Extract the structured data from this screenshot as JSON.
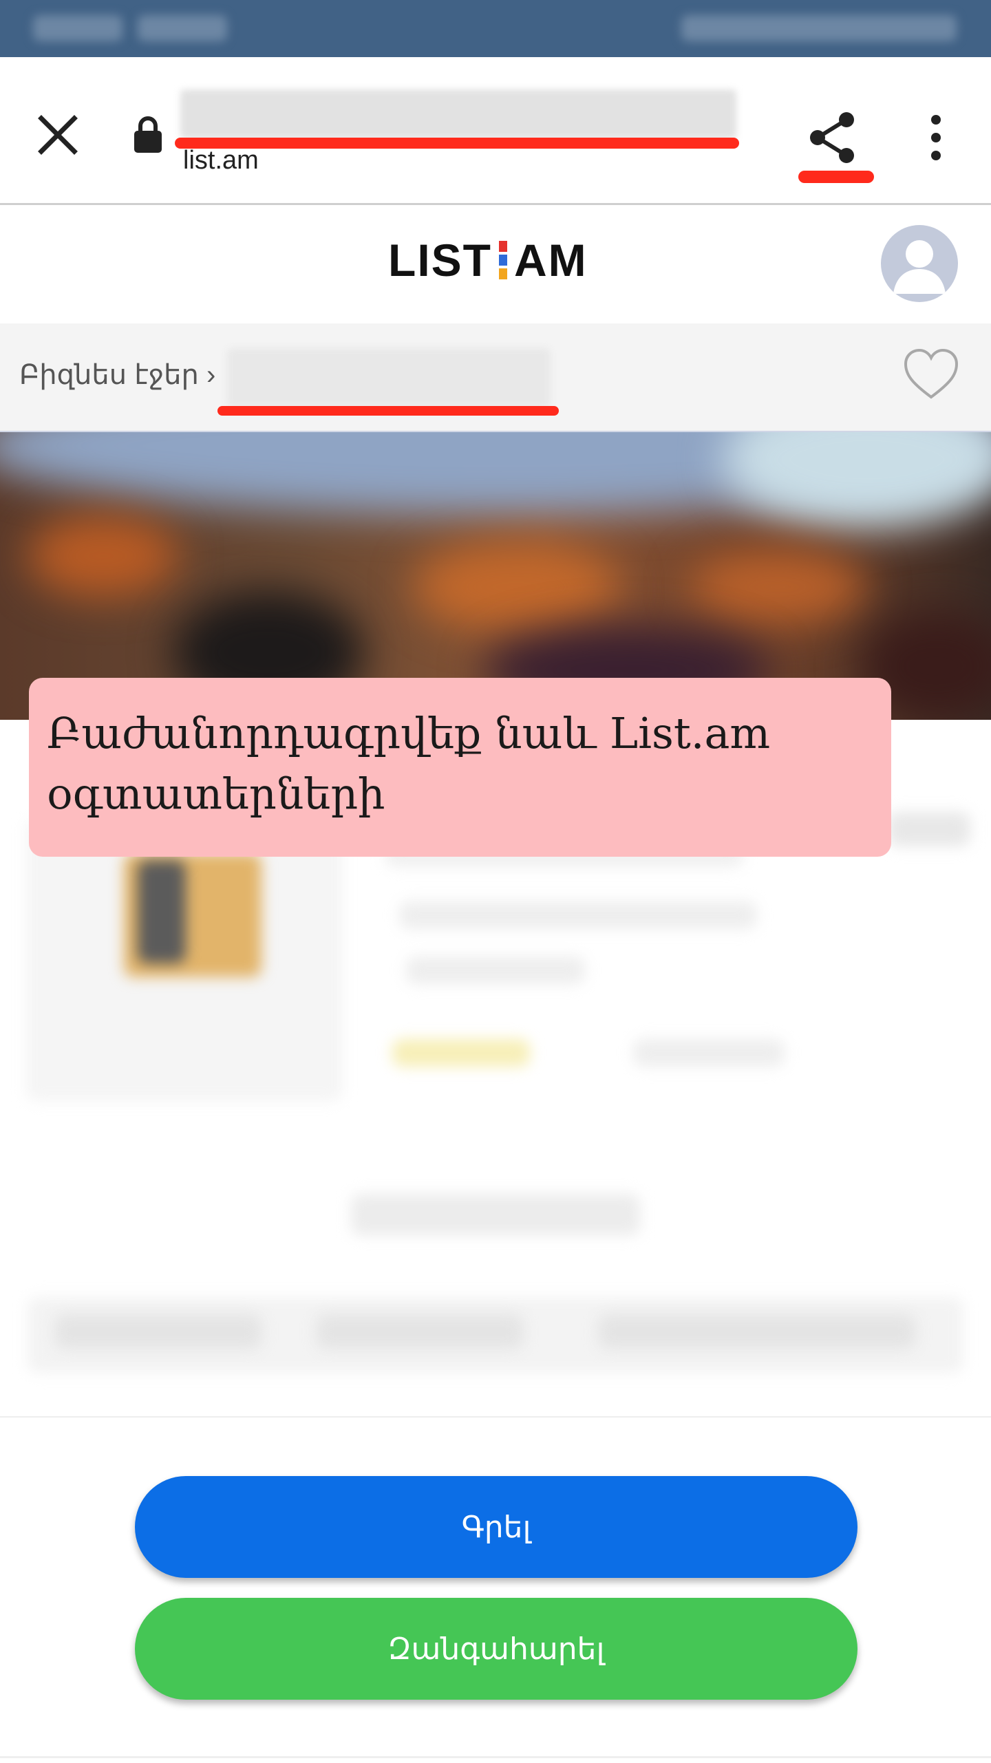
{
  "browser": {
    "domain": "list.am"
  },
  "site": {
    "logo_left": "LIST",
    "logo_right": "AM"
  },
  "breadcrumb": {
    "label": "Բիզնես էջեր ›"
  },
  "promo": {
    "text": "Բաժանորդագրվեք նաև List.am օգտատերների"
  },
  "actions": {
    "write_label": "Գրել",
    "call_label": "Զանգահարել"
  },
  "colors": {
    "status_bar": "#416286",
    "promo_bg": "#fdbcbf",
    "write_button": "#0c6ee6",
    "call_button": "#45c655",
    "highlight_red": "#ff2a1c"
  }
}
